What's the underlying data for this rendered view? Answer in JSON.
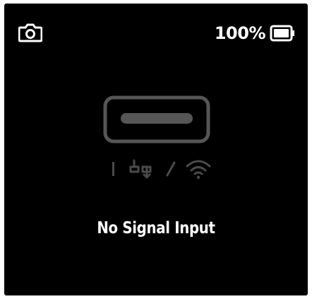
{
  "status_bar": {
    "mode_icon": "camera-icon",
    "battery_percent": "100%",
    "battery_icon": "battery-full-icon"
  },
  "center_graphic": {
    "port_icon": "usb-port-icon",
    "connection_icons": [
      "cable-icon",
      "displayport-icon",
      "wifi-icon"
    ]
  },
  "message": "No Signal Input",
  "colors": {
    "background": "#000000",
    "text": "#ffffff",
    "icon_dim": "#555555"
  }
}
